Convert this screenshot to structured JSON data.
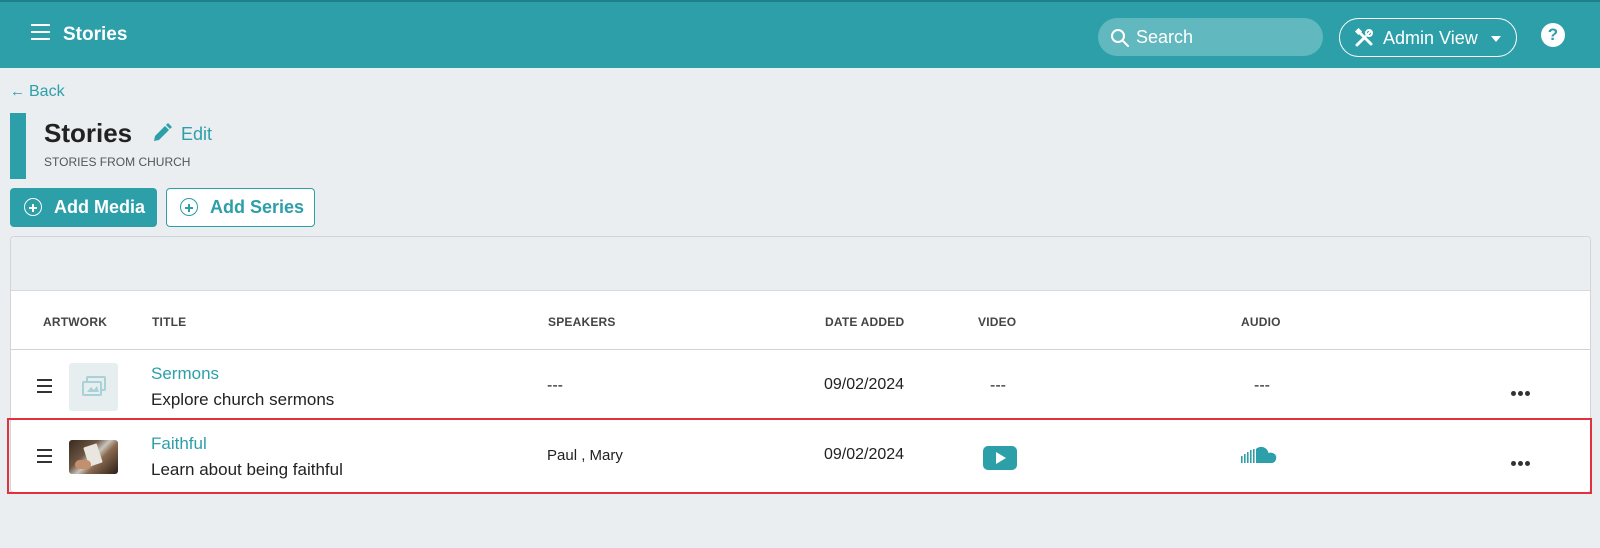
{
  "header": {
    "title": "Stories",
    "search_placeholder": "Search",
    "admin_view_label": "Admin View",
    "help_label": "?"
  },
  "page": {
    "back_label": "Back",
    "title": "Stories",
    "edit_label": "Edit",
    "subtitle": "STORIES FROM CHURCH"
  },
  "actions": {
    "add_media": "Add Media",
    "add_series": "Add Series"
  },
  "table": {
    "columns": {
      "artwork": "ARTWORK",
      "title": "TITLE",
      "speakers": "SPEAKERS",
      "date_added": "DATE ADDED",
      "video": "VIDEO",
      "audio": "AUDIO"
    },
    "rows": [
      {
        "title": "Sermons",
        "description": "Explore church sermons",
        "speakers": "---",
        "date_added": "09/02/2024",
        "video": "---",
        "audio": "---",
        "artwork": "series-placeholder-icon"
      },
      {
        "title": "Faithful",
        "description": "Learn about being faithful",
        "speakers": "Paul , Mary",
        "date_added": "09/02/2024",
        "video": "play-icon",
        "audio": "soundcloud-icon",
        "artwork": "photo-thumbnail",
        "selected": true
      }
    ]
  },
  "colors": {
    "brand": "#2c9fa9",
    "selection_outline": "#e0323c",
    "page_background": "#ebeef0"
  }
}
